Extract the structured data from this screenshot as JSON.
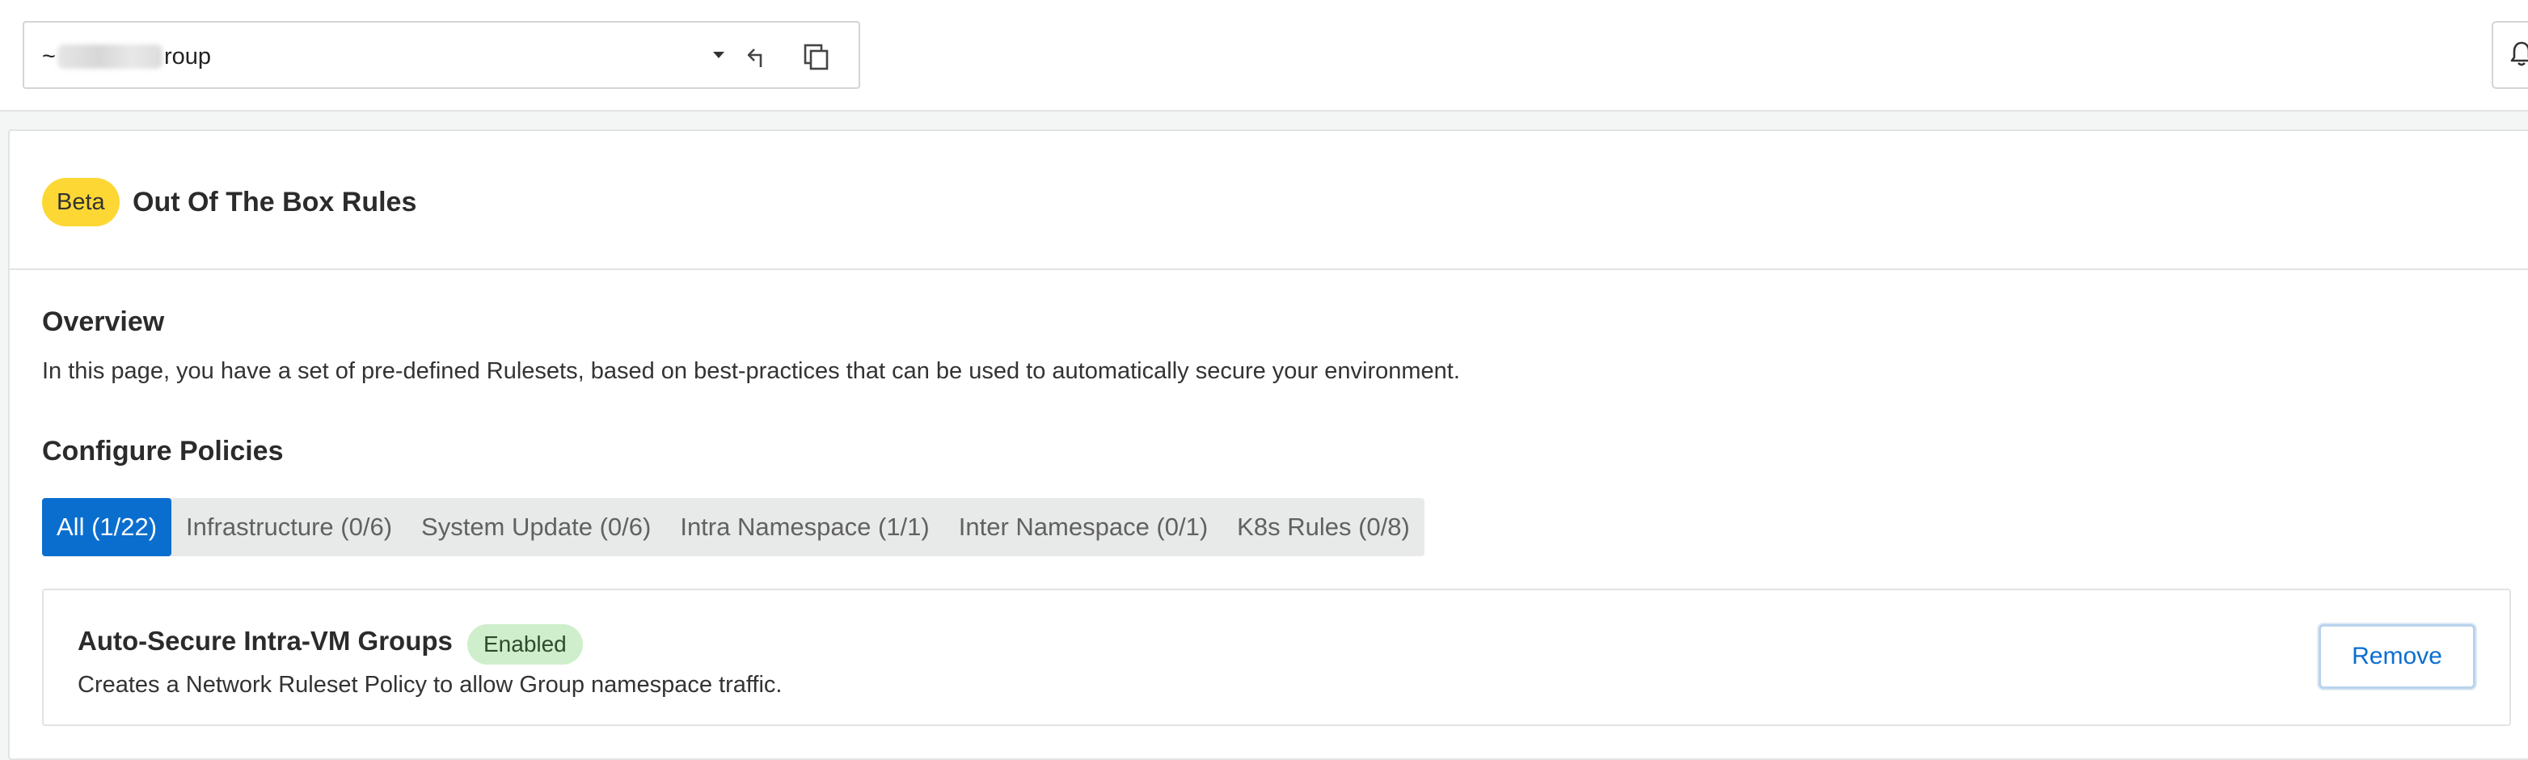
{
  "header": {
    "group_prefix": "~",
    "group_suffix": "roup",
    "icons": [
      "caret-down-icon",
      "back-arrow-icon",
      "copy-icon",
      "bell-icon"
    ]
  },
  "page": {
    "badge": "Beta",
    "title": "Out Of The Box Rules"
  },
  "overview": {
    "title": "Overview",
    "text": "In this page, you have a set of pre-defined Rulesets, based on best-practices that can be used to automatically secure your environment."
  },
  "policies": {
    "title": "Configure Policies",
    "tabs": [
      {
        "label": "All (1/22)",
        "active": true
      },
      {
        "label": "Infrastructure (0/6)",
        "active": false
      },
      {
        "label": "System Update (0/6)",
        "active": false
      },
      {
        "label": "Intra Namespace (1/1)",
        "active": false
      },
      {
        "label": "Inter Namespace (0/1)",
        "active": false
      },
      {
        "label": "K8s Rules (0/8)",
        "active": false
      }
    ]
  },
  "rules": [
    {
      "title": "Auto-Secure Intra-VM Groups",
      "status": "Enabled",
      "description": "Creates a Network Ruleset Policy to allow Group namespace traffic.",
      "action_label": "Remove"
    }
  ],
  "colors": {
    "accent": "#0a6ecf",
    "beta_badge": "#fdd835",
    "enabled_badge": "#cfeecb"
  }
}
